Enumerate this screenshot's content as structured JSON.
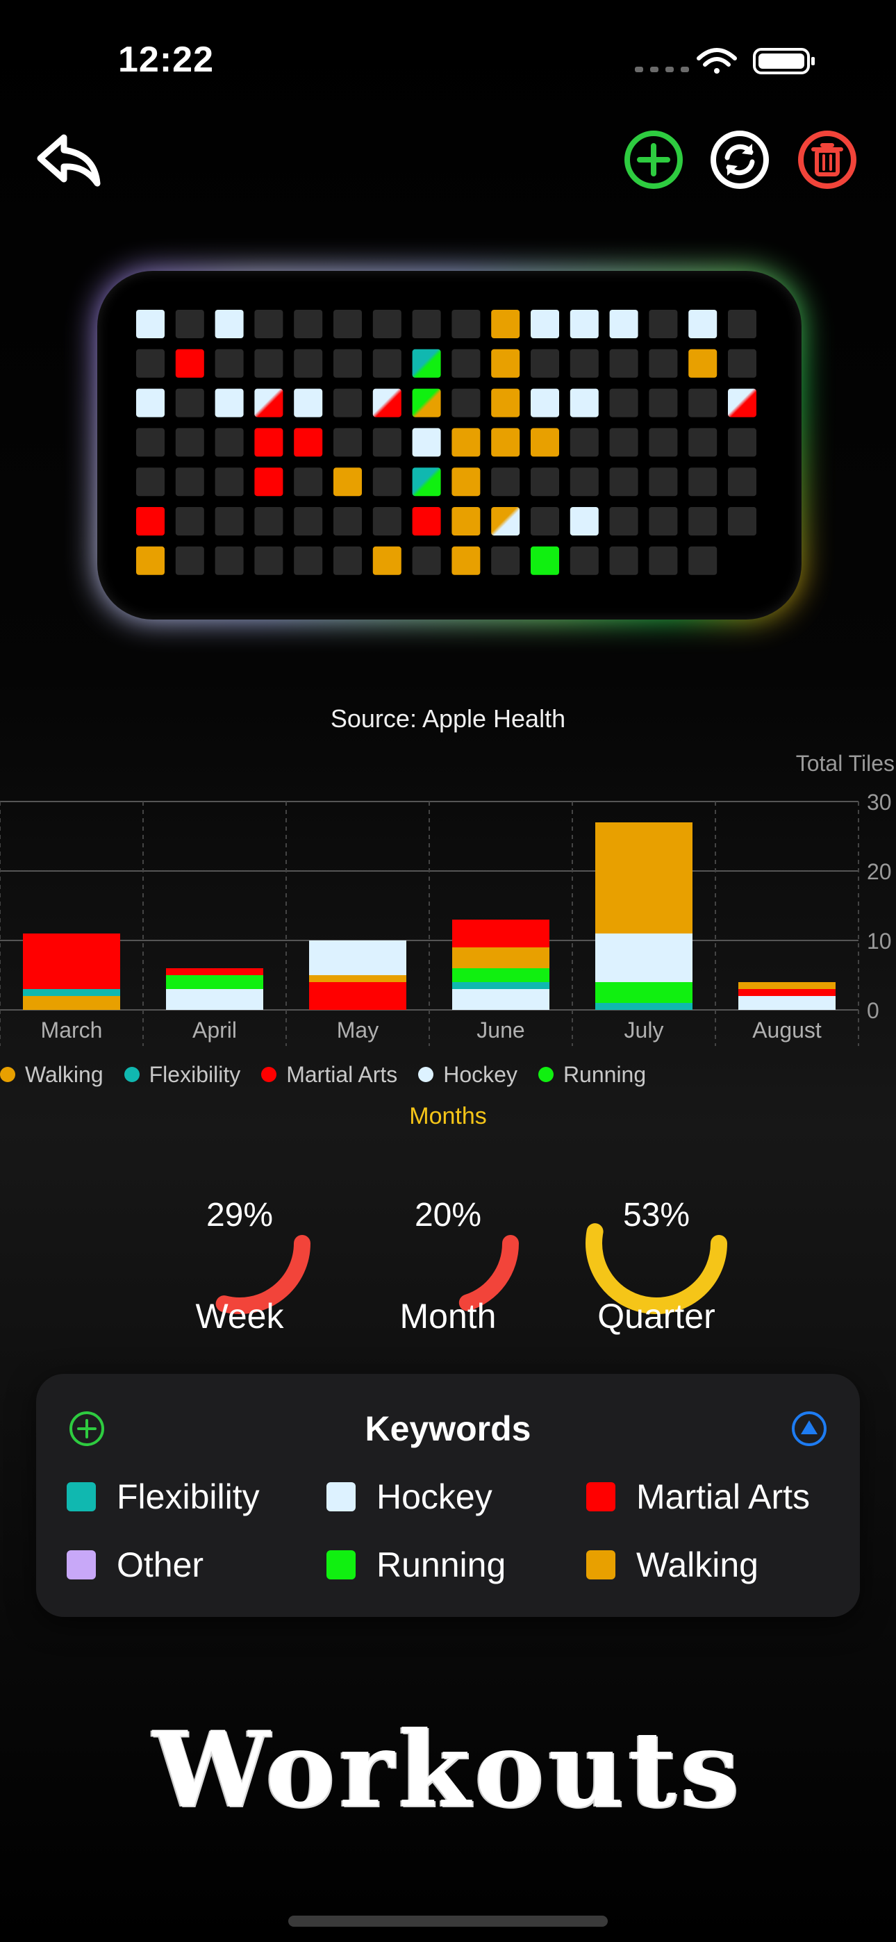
{
  "status_bar": {
    "time": "12:22"
  },
  "toolbar": {
    "back_icon": "back-arrow-icon",
    "add_icon": "plus-circle-icon",
    "sync_icon": "sync-icon",
    "delete_icon": "trash-icon"
  },
  "colors": {
    "walking": "#E8A000",
    "flexibility": "#10B8B0",
    "martial_arts": "#FF0000",
    "hockey": "#DDF2FF",
    "running": "#10F010",
    "other": "#C8A8F8",
    "empty": "#2A2A2A",
    "ring_red": "#F2443A",
    "ring_yellow": "#F5C518",
    "add_green": "#2ECC40",
    "delete_red": "#F2443A",
    "info_blue": "#1E7CF2"
  },
  "board": {
    "cols": 16,
    "rows": [
      [
        "H",
        "E",
        "H",
        "E",
        "E",
        "E",
        "E",
        "E",
        "E",
        "W",
        "H",
        "H",
        "H",
        "E",
        "H",
        "E"
      ],
      [
        "E",
        "M",
        "E",
        "E",
        "E",
        "E",
        "E",
        "FR",
        "E",
        "W",
        "E",
        "E",
        "E",
        "E",
        "W",
        "E"
      ],
      [
        "H",
        "E",
        "H",
        "HM",
        "H",
        "E",
        "HM",
        "RW",
        "E",
        "W",
        "H",
        "H",
        "E",
        "E",
        "E",
        "HM"
      ],
      [
        "E",
        "E",
        "E",
        "M",
        "M",
        "E",
        "E",
        "H",
        "W",
        "W",
        "W",
        "E",
        "E",
        "E",
        "E",
        "E"
      ],
      [
        "E",
        "E",
        "E",
        "M",
        "E",
        "W",
        "E",
        "FR",
        "W",
        "E",
        "E",
        "E",
        "E",
        "E",
        "E",
        "E"
      ],
      [
        "M",
        "E",
        "E",
        "E",
        "E",
        "E",
        "E",
        "M",
        "W",
        "WH",
        "E",
        "H",
        "E",
        "E",
        "E",
        "E"
      ],
      [
        "W",
        "E",
        "E",
        "E",
        "E",
        "E",
        "W",
        "E",
        "W",
        "E",
        "R",
        "E",
        "E",
        "E",
        "E",
        "N"
      ]
    ]
  },
  "source": "Source: Apple Health",
  "chart_data": {
    "type": "bar",
    "stacked": true,
    "categories": [
      "March",
      "April",
      "May",
      "June",
      "July",
      "August"
    ],
    "ylabel": "Total Tiles",
    "xlabel": "Months",
    "ylim": [
      0,
      30
    ],
    "yticks": [
      0,
      10,
      20,
      30
    ],
    "grid": true,
    "legend_position": "bottom",
    "series": [
      {
        "name": "Walking",
        "color": "#E8A000",
        "values": [
          2,
          0,
          1,
          3,
          16,
          1
        ]
      },
      {
        "name": "Flexibility",
        "color": "#10B8B0",
        "values": [
          1,
          0,
          0,
          1,
          1,
          0
        ]
      },
      {
        "name": "Martial Arts",
        "color": "#FF0000",
        "values": [
          8,
          1,
          4,
          4,
          0,
          1
        ]
      },
      {
        "name": "Hockey",
        "color": "#DDF2FF",
        "values": [
          0,
          3,
          5,
          3,
          7,
          2
        ]
      },
      {
        "name": "Running",
        "color": "#10F010",
        "values": [
          0,
          2,
          0,
          2,
          3,
          0
        ]
      }
    ],
    "stack_order": [
      [
        "Walking",
        "Flexibility",
        "Martial Arts"
      ],
      [
        "Hockey",
        "Running",
        "Martial Arts"
      ],
      [
        "Martial Arts",
        "Walking",
        "Hockey"
      ],
      [
        "Hockey",
        "Flexibility",
        "Running",
        "Walking",
        "Martial Arts"
      ],
      [
        "Flexibility",
        "Running",
        "Hockey",
        "Walking"
      ],
      [
        "Hockey",
        "Martial Arts",
        "Walking"
      ]
    ]
  },
  "progress": [
    {
      "label": "Week",
      "percent": 29,
      "value_text": "29%",
      "color": "#F2443A"
    },
    {
      "label": "Month",
      "percent": 20,
      "value_text": "20%",
      "color": "#F2443A"
    },
    {
      "label": "Quarter",
      "percent": 53,
      "value_text": "53%",
      "color": "#F5C518"
    }
  ],
  "keywords": {
    "title": "Keywords",
    "add_icon": "plus-circle-icon",
    "collapse_icon": "triangle-up-circle-icon",
    "items": [
      {
        "label": "Flexibility",
        "color": "#10B8B0"
      },
      {
        "label": "Hockey",
        "color": "#DDF2FF"
      },
      {
        "label": "Martial Arts",
        "color": "#FF0000"
      },
      {
        "label": "Other",
        "color": "#C8A8F8"
      },
      {
        "label": "Running",
        "color": "#10F010"
      },
      {
        "label": "Walking",
        "color": "#E8A000"
      }
    ]
  },
  "app_title": "Workouts"
}
